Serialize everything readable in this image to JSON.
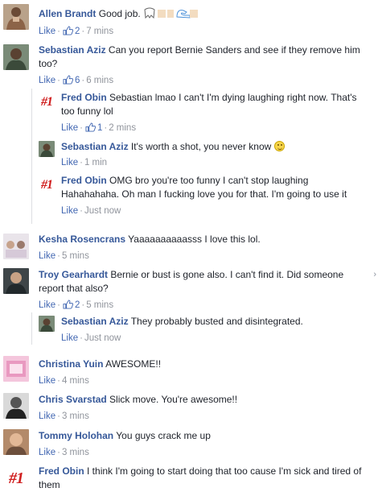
{
  "comments": [
    {
      "name": "Allen Brandt",
      "text": "Good job.",
      "like": "Like",
      "likes": "2",
      "time": "7 mins",
      "avatar": "allen-avatar",
      "emoji": "teeth-and-flex-emoji"
    },
    {
      "name": "Sebastian Aziz",
      "text": "Can you report Bernie Sanders and see if they remove him too?",
      "like": "Like",
      "likes": "6",
      "time": "6 mins",
      "avatar": "sebastian-avatar"
    },
    {
      "name": "Fred Obin",
      "text": "Sebastian lmao I can't I'm dying laughing right now. That's too funny lol",
      "like": "Like",
      "likes": "1",
      "time": "2 mins",
      "avatar": "fred-avatar"
    },
    {
      "name": "Sebastian Aziz",
      "text": "It's worth a shot, you never know",
      "like": "Like",
      "time": "1 min",
      "avatar": "sebastian-avatar"
    },
    {
      "name": "Fred Obin",
      "text": "OMG bro you're too funny I can't stop laughing Hahahahaha. Oh man I fucking love you for that. I'm going to use it",
      "like": "Like",
      "time": "Just now",
      "avatar": "fred-avatar"
    },
    {
      "name": "Kesha Rosencrans",
      "text": "Yaaaaaaaaaasss I love this lol.",
      "like": "Like",
      "time": "5 mins",
      "avatar": "kesha-avatar"
    },
    {
      "name": "Troy Gearhardt",
      "text": "Bernie or bust is gone also. I can't find it. Did someone report that also?",
      "like": "Like",
      "likes": "2",
      "time": "5 mins",
      "avatar": "troy-avatar"
    },
    {
      "name": "Sebastian Aziz",
      "text": "They probably busted and disintegrated.",
      "like": "Like",
      "time": "Just now",
      "avatar": "sebastian-avatar"
    },
    {
      "name": "Christina Yuin",
      "text": "AWESOME!!",
      "like": "Like",
      "time": "4 mins",
      "avatar": "christina-avatar"
    },
    {
      "name": "Chris Svarstad",
      "text": "Slick move. You're awesome!!",
      "like": "Like",
      "time": "3 mins",
      "avatar": "chris-avatar"
    },
    {
      "name": "Tommy Holohan",
      "text": "You guys crack me up",
      "like": "Like",
      "time": "3 mins",
      "avatar": "tommy-avatar"
    },
    {
      "name": "Fred Obin",
      "text": "I think I'm going to start doing that too cause I'm sick and tired of them",
      "avatar": "fred-avatar"
    }
  ],
  "fred_badge": "#1",
  "dot": "·",
  "chevron": "›",
  "colors": {
    "name": "#365899",
    "link": "#4267b2",
    "meta": "#90949c",
    "fred_badge": "#d01f1f"
  }
}
